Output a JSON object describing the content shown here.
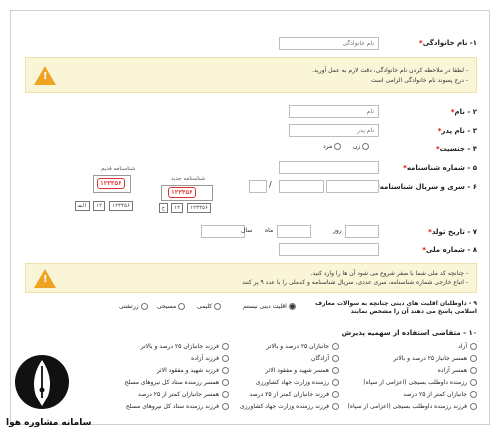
{
  "q1": {
    "label": "۱- نام خانوادگی",
    "placeholder": "نام خانوادگی"
  },
  "warning1": {
    "lines": [
      "- لطفا در ملاحظه کردن نام خانوادگی، دقت لازم به عمل آورید.",
      "- درج پسوند نام خانوادگی الزامی است"
    ]
  },
  "q2": {
    "label": "۲ - نام",
    "placeholder": "نام"
  },
  "q3": {
    "label": "۳ - نام پدر",
    "placeholder": "نام پدر"
  },
  "q4": {
    "label": "۴ - جنسیت",
    "options": [
      "زن",
      "مرد"
    ]
  },
  "q5": {
    "label": "۵ - شماره شناسنامه"
  },
  "q6": {
    "label": "۶ - سری و سریال شناسنامه",
    "sep": "/"
  },
  "samples": {
    "old_title": "شناسنامه قدیم",
    "new_title": "شناسنامه جدید",
    "old_serial": "۱۲۳۴۵۶",
    "new_serial": "۱۲۳۴۵۶",
    "old_boxes": [
      "۱۲۳۴۵۶",
      "۱۲",
      "الف"
    ],
    "new_boxes": [
      "۱۲۳۴۵۶",
      "۱۲",
      "ح"
    ]
  },
  "q7": {
    "label": "۷ - تاریخ تولد",
    "day": "روز",
    "month": "ماه",
    "year": "سال"
  },
  "q8": {
    "label": "۸ - شماره ملی"
  },
  "warning2": {
    "lines": [
      "- چنانچه کد ملی شما با صفر شروع می شود آن ها را وارد کنید.",
      "- اتباع خارجی شماره شناسنامه، سری عددی، سریال شناسنامه و کدملی را با عدد ۹ پر کنند"
    ]
  },
  "q9": {
    "label": "۹ - داوطلبان اقلیت های دینی چنانچه به سوالات معارف اسلامی پاسخ می دهند آن را مشخص نمایند",
    "options": [
      "اقلیت دینی نیستم",
      "کلیمی",
      "مسیحی",
      "زرتشتی"
    ]
  },
  "q10": {
    "label": "۱۰ - متقاضی استفاده از سهمیه پذیرش",
    "col1": [
      "آزاد",
      "همسر جانباز ۲۵ درصد و بالاتر",
      "همسر آزاده",
      "رزمنده داوطلب بسیجی (اعزامی از سپاه)",
      "جانبازان کمتر از ۲۵ درصد",
      "فرزند رزمنده داوطلب بسیجی (اعزامی از سپاه)"
    ],
    "col2": [
      "جانبازان ۲۵ درصد و بالاتر",
      "آزادگان",
      "همسر شهید و مفقود الاثر",
      "رزمنده وزارت جهاد کشاورزی",
      "فرزند جانبازان کمتر از ۲۵ درصد",
      "فرزند رزمنده وزارت جهاد کشاورزی"
    ],
    "col3": [
      "فرزند جانبازان ۲۵ درصد و بالاتر",
      "فرزند آزاده",
      "فرزند شهید و مفقود الاثر",
      "همسر رزمنده ستاد کل نیروهای مسلح",
      "همسر جانبازان کمتر از ۲۵ درصد",
      "فرزند رزمنده ستاد کل نیروهای مسلح"
    ]
  },
  "brand": {
    "name": "سامانه مشاوره هوا"
  }
}
